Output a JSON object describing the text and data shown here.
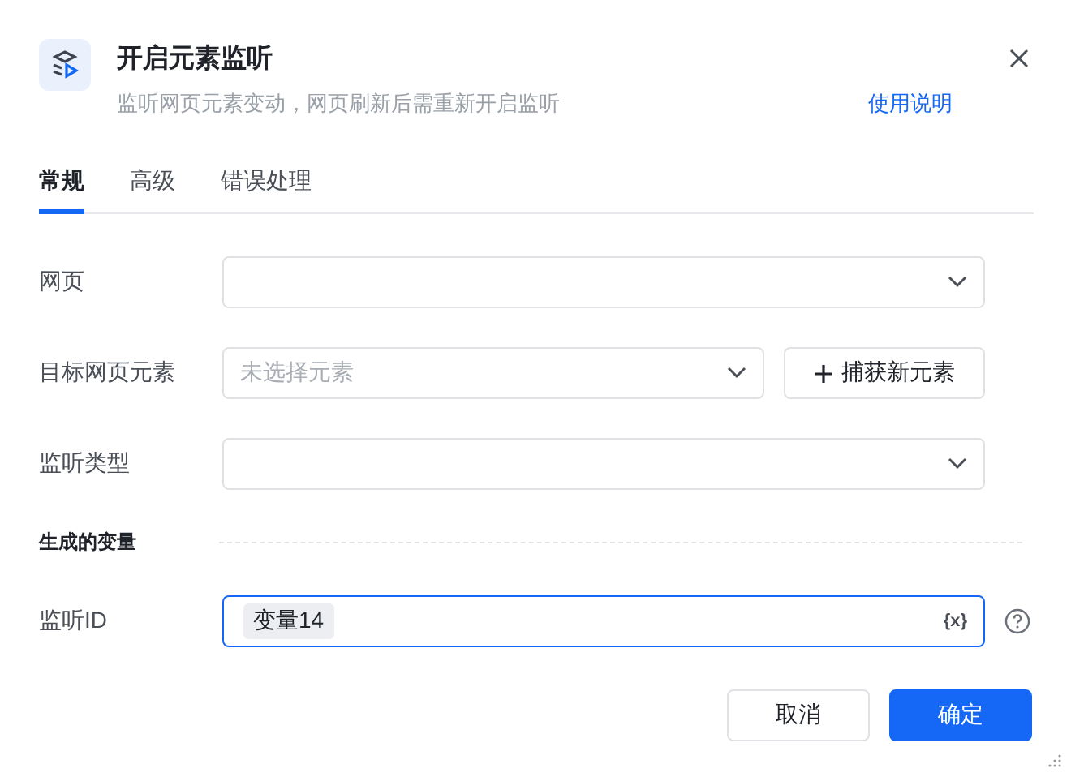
{
  "dialog": {
    "title": "开启元素监听",
    "subtitle": "监听网页元素变动，网页刷新后需重新开启监听",
    "help_link": "使用说明"
  },
  "tabs": [
    {
      "label": "常规",
      "selected": true
    },
    {
      "label": "高级",
      "selected": false
    },
    {
      "label": "错误处理",
      "selected": false
    }
  ],
  "fields": [
    {
      "kind": "select",
      "label": "网页"
    },
    {
      "kind": "select_button",
      "label": "目标网页元素",
      "placeholder": "未选择元素",
      "button": "捕获新元素"
    },
    {
      "kind": "select",
      "label": "监听类型"
    }
  ],
  "section": {
    "title": "生成的变量"
  },
  "outputs": [
    {
      "kind": "variable",
      "label": "监听ID",
      "token": "变量14",
      "variable_glyph": "{x}",
      "focused": true
    }
  ],
  "buttons": [
    {
      "label": "取消",
      "primary": false
    },
    {
      "label": "确定",
      "primary": true
    }
  ]
}
